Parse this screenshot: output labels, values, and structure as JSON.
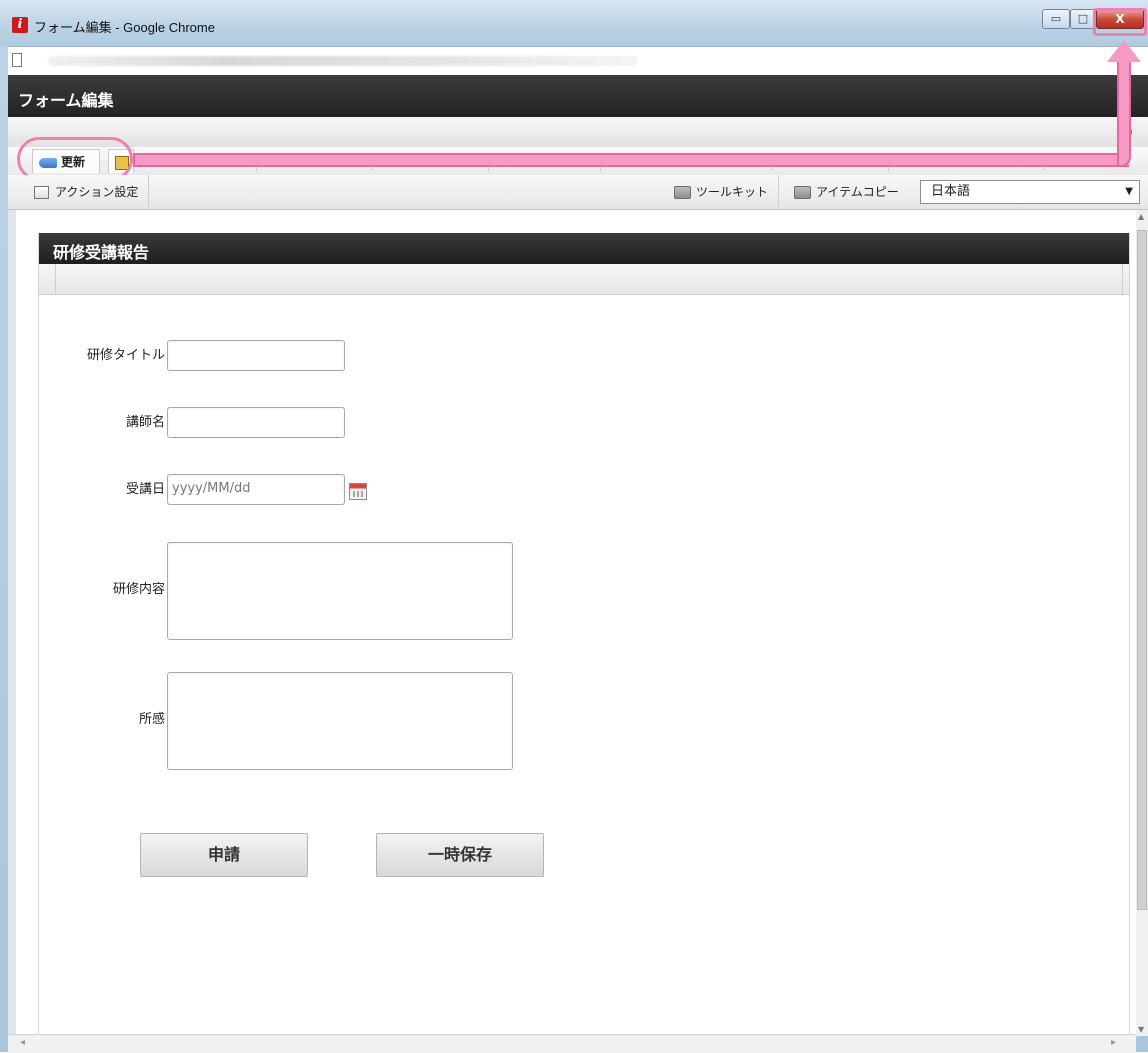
{
  "window": {
    "title": "フォーム編集 - Google Chrome",
    "app_icon_letter": "i",
    "minimize_glyph": "▭",
    "maximize_glyph": "□",
    "close_glyph": "X"
  },
  "address_bar": {
    "url": ""
  },
  "app_header": {
    "title": "フォーム編集"
  },
  "tabs": [
    {
      "label": "更新",
      "icon": "update-icon"
    },
    {
      "label": "",
      "icon": "folder-icon"
    }
  ],
  "toolbar": {
    "action_label": "アクション設定",
    "toolkit_label": "ツールキット",
    "item_copy_label": "アイテムコピー",
    "language_selected": "日本語",
    "dropdown_glyph": "▼"
  },
  "form": {
    "title": "研修受講報告",
    "fields": {
      "training_title_label": "研修タイトル",
      "instructor_label": "講師名",
      "date_label": "受講日",
      "date_placeholder": "yyyy/MM/dd",
      "content_label": "研修内容",
      "impressions_label": "所感"
    },
    "buttons": {
      "apply": "申請",
      "save_draft": "一時保存"
    }
  },
  "colors": {
    "highlight": "#ef7fb1",
    "header_bg": "#2b2b2b",
    "close_button": "#c84535"
  }
}
